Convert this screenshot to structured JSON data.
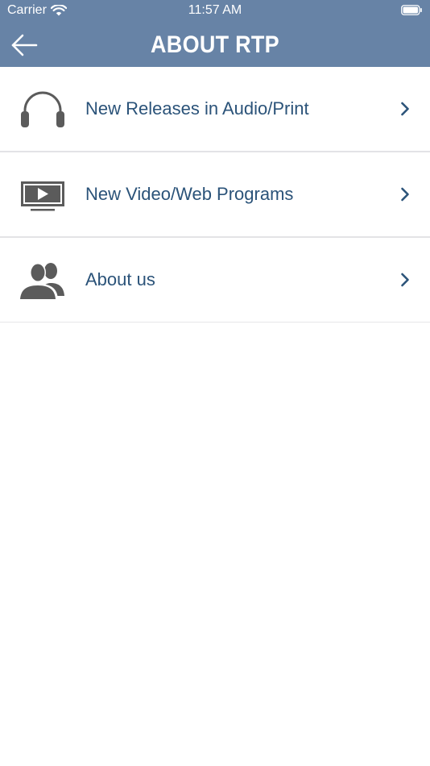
{
  "status_bar": {
    "carrier": "Carrier",
    "time": "11:57 AM"
  },
  "nav": {
    "title": "ABOUT RTP",
    "back_icon": "arrow-left-icon"
  },
  "menu": {
    "items": [
      {
        "label": "New Releases in Audio/Print",
        "icon": "headphones-icon"
      },
      {
        "label": "New Video/Web Programs",
        "icon": "video-monitor-icon"
      },
      {
        "label": "About us",
        "icon": "users-icon"
      }
    ]
  },
  "colors": {
    "header_bg": "#6783a6",
    "label_text": "#2b5379",
    "icon_gray": "#5b5b5b",
    "divider": "#e3e3e6"
  }
}
